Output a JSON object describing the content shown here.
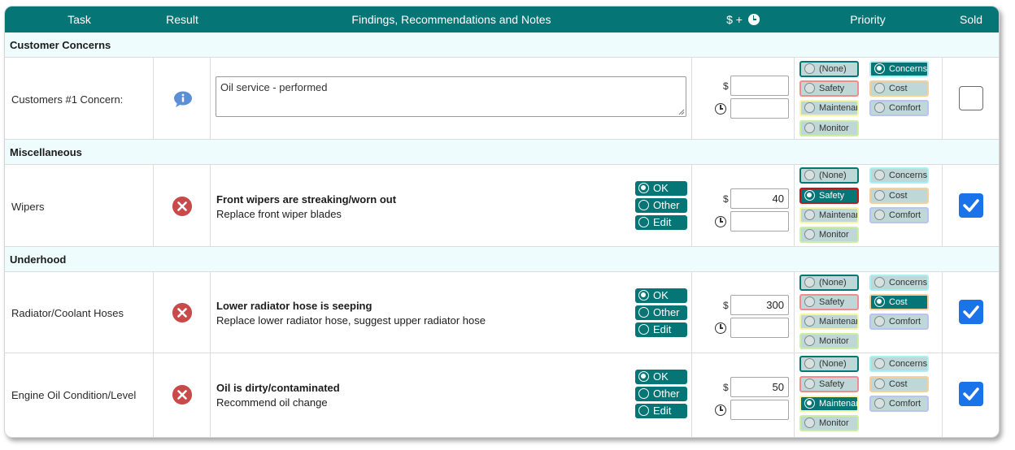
{
  "header": {
    "task": "Task",
    "result": "Result",
    "findings": "Findings, Recommendations and Notes",
    "cost_time": "$ +",
    "priority": "Priority",
    "sold": "Sold"
  },
  "priority_labels": {
    "none": "(None)",
    "safety": "Safety",
    "maintenance": "Maintenance",
    "monitor": "Monitor",
    "concerns": "Concerns",
    "cost": "Cost",
    "comfort": "Comfort"
  },
  "finding_actions": {
    "ok": "OK",
    "other": "Other",
    "edit": "Edit"
  },
  "field_labels": {
    "dollar": "$"
  },
  "sections": {
    "customer_concerns": "Customer Concerns",
    "miscellaneous": "Miscellaneous",
    "underhood": "Underhood"
  },
  "rows": [
    {
      "task": "Customers #1 Concern:",
      "result": "info",
      "notes": "Oil service - performed",
      "price": "",
      "time": "",
      "priority": "concerns",
      "sold": false
    },
    {
      "task": "Wipers",
      "result": "fail",
      "finding_title": "Front wipers are streaking/worn out",
      "finding_note": "Replace front wiper blades",
      "action": "ok",
      "price": "40",
      "time": "",
      "priority": "safety",
      "sold": true
    },
    {
      "task": "Radiator/Coolant Hoses",
      "result": "fail",
      "finding_title": "Lower radiator hose is seeping",
      "finding_note": "Replace lower radiator hose, suggest upper radiator hose",
      "action": "ok",
      "price": "300",
      "time": "",
      "priority": "cost",
      "sold": true
    },
    {
      "task": "Engine Oil Condition/Level",
      "result": "fail",
      "finding_title": "Oil is dirty/contaminated",
      "finding_note": "Recommend oil change",
      "action": "ok",
      "price": "50",
      "time": "",
      "priority": "maintenance",
      "sold": true
    }
  ],
  "colors": {
    "header_bg": "#067575",
    "section_bg": "#effcfe",
    "fail_icon": "#c94a4a",
    "info_icon": "#5b8fd6",
    "checkbox_checked": "#1a73e8"
  },
  "icons": {
    "header_time": "clock-icon",
    "fail": "x-circle-icon",
    "info": "info-bubble-icon",
    "time": "clock-icon",
    "checked": "checkmark-icon"
  }
}
